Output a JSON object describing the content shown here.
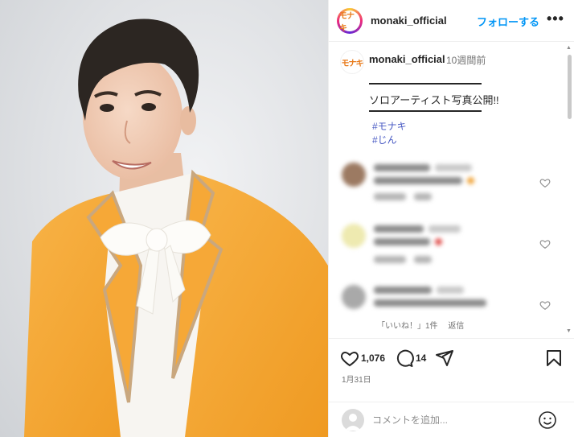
{
  "header": {
    "logo_text": "モナキ",
    "username": "monaki_official",
    "follow_label": "フォローする",
    "more_label": "•••"
  },
  "caption": {
    "username": "monaki_official",
    "time": "10週間前",
    "text": "ソロアーティスト写真公開!!",
    "hashtags": [
      "#モナキ",
      "#じん"
    ]
  },
  "comments_footer": {
    "likes_label": "「いいね！」1件",
    "reply_label": "返信"
  },
  "actions": {
    "like_count": "1,076",
    "comment_count": "14",
    "date": "1月31日"
  },
  "comment_box": {
    "placeholder": "コメントを追加..."
  },
  "colors": {
    "accent": "#0095f6",
    "jacket": "#f5a636",
    "text": "#262626",
    "muted": "#737373"
  },
  "icons": [
    "more-icon",
    "heart-icon",
    "comment-icon",
    "share-icon",
    "bookmark-icon",
    "emoji-icon",
    "avatar-icon"
  ]
}
